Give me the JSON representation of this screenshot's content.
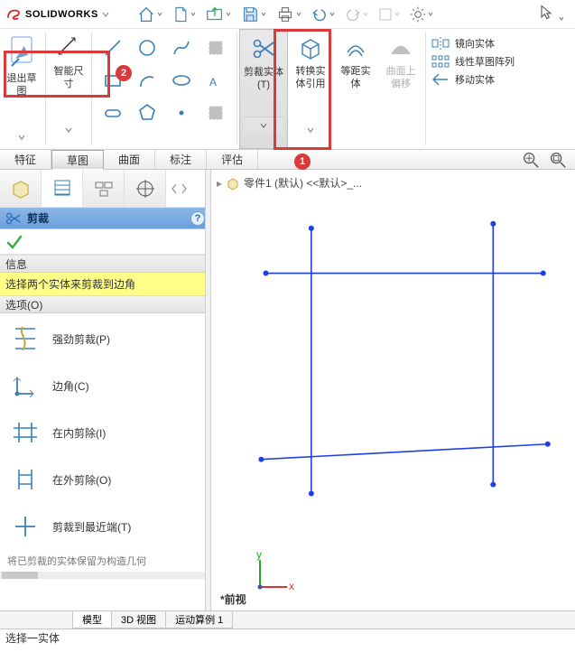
{
  "brand": {
    "name": "SOLIDWORKS"
  },
  "ribbon": {
    "exit_sketch": "退出草图",
    "smart_dim": "智能尺寸",
    "trim": "剪裁实体(T)",
    "convert": "转换实体引用",
    "offset": "等距实体",
    "surface_offset": "曲面上偏移",
    "mirror": "镜向实体",
    "linear_pattern": "线性草图阵列",
    "move": "移动实体"
  },
  "tabs": {
    "items": [
      "特征",
      "草图",
      "曲面",
      "标注",
      "评估"
    ],
    "active_index": 1
  },
  "crumb": {
    "part": "零件1 (默认) <<默认>_..."
  },
  "panel": {
    "title": "剪裁",
    "info_h": "信息",
    "info_msg": "选择两个实体来剪裁到边角",
    "options_h": "选项(O)",
    "options": [
      {
        "label": "强劲剪裁(P)"
      },
      {
        "label": "边角(C)"
      },
      {
        "label": "在内剪除(I)"
      },
      {
        "label": "在外剪除(O)"
      },
      {
        "label": "剪裁到最近端(T)"
      }
    ],
    "foot": "将已剪裁的实体保留为构造几何"
  },
  "view_label": "前视",
  "doctabs": {
    "items": [
      "模型",
      "3D 视图",
      "运动算例 1"
    ],
    "active_index": 0
  },
  "status": "选择一实体",
  "annotations": {
    "badge1": "1",
    "badge2": "2"
  }
}
